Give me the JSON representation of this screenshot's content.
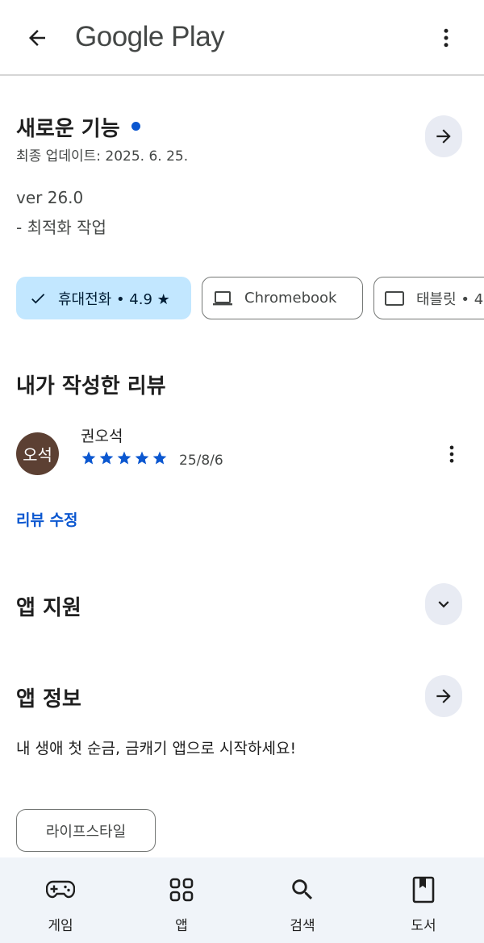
{
  "header": {
    "logo_text": "Google Play",
    "back_icon": "arrow-back-icon",
    "more_icon": "more-vert-icon"
  },
  "whats_new": {
    "title": "새로운 기능",
    "updated": "최종 업데이트: 2025. 6. 25.",
    "version": "ver 26.0",
    "notes": "- 최적화 작업"
  },
  "device_chips": [
    {
      "label": "휴대전화 • 4.9 ★",
      "icon": "check-icon",
      "selected": true
    },
    {
      "label": "Chromebook",
      "icon": "laptop-icon",
      "selected": false
    },
    {
      "label": "태블릿 • 4",
      "icon": "tablet-icon",
      "selected": false
    }
  ],
  "my_review": {
    "title": "내가 작성한 리뷰",
    "avatar_text": "오석",
    "reviewer_name": "권오석",
    "rating": 5,
    "date": "25/8/6",
    "edit_label": "리뷰 수정"
  },
  "app_support": {
    "title": "앱 지원"
  },
  "app_info": {
    "title": "앱 정보",
    "description": "내 생애 첫 순금, 금캐기 앱으로 시작하세요!",
    "tag": "라이프스타일"
  },
  "bottom_nav": [
    {
      "label": "게임",
      "icon": "gamepad-icon"
    },
    {
      "label": "앱",
      "icon": "apps-grid-icon"
    },
    {
      "label": "검색",
      "icon": "search-icon"
    },
    {
      "label": "도서",
      "icon": "book-icon"
    }
  ],
  "colors": {
    "accent_blue": "#0b57d0",
    "chip_selected_bg": "#c2e7ff",
    "circle_button_bg": "#e8ebf3",
    "avatar_bg": "#5c4033",
    "bottom_nav_bg": "#f0f4f9"
  }
}
